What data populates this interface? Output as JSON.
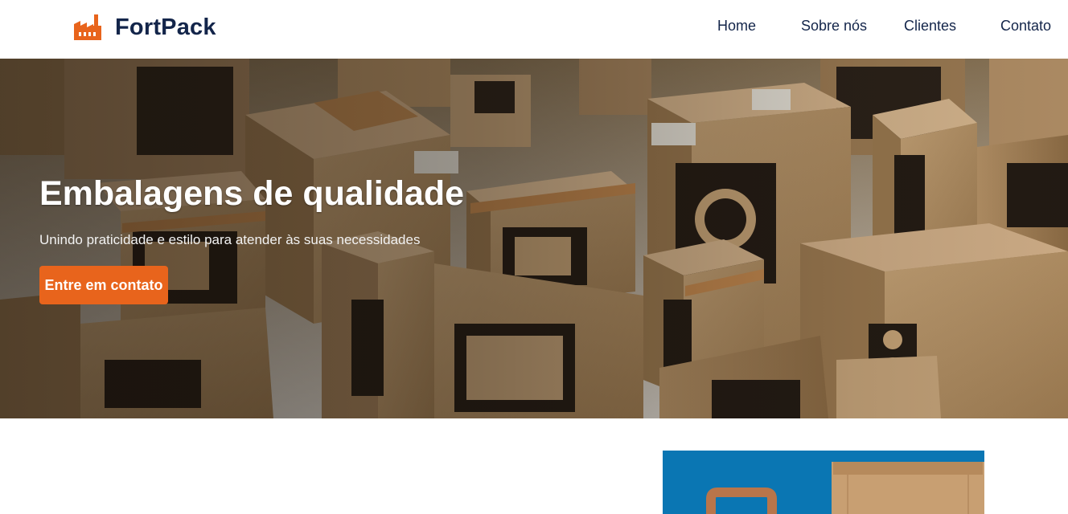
{
  "brand": {
    "name": "FortPack",
    "logo_icon": "factory-icon",
    "accent_color": "#e8641c",
    "text_color": "#13254a"
  },
  "nav": {
    "items": [
      {
        "label": "Home"
      },
      {
        "label": "Sobre nós"
      },
      {
        "label": "Clientes"
      },
      {
        "label": "Contato"
      }
    ]
  },
  "hero": {
    "title": "Embalagens de qualidade",
    "subtitle": "Unindo praticidade e estilo para atender às suas necessidades",
    "cta_label": "Entre em contato"
  },
  "feature": {
    "background_color": "#0a76b3"
  }
}
